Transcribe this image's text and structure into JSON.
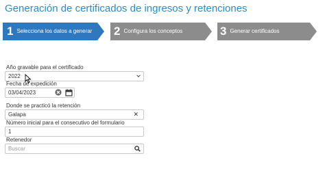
{
  "page": {
    "title": "Generación de certificados de ingresos y retenciones"
  },
  "steps": [
    {
      "number": "1",
      "label": "Selecciona los datos a generar",
      "state": "active",
      "color": "#2f78bd"
    },
    {
      "number": "2",
      "label": "Configura los conceptos",
      "state": "inactive",
      "color": "#8c8c8c"
    },
    {
      "number": "3",
      "label": "Generar certificados",
      "state": "inactive",
      "color": "#8c8c8c"
    }
  ],
  "form": {
    "year": {
      "label": "Año gravable para el certificado",
      "value": "2022",
      "icon": "chevron-down-icon"
    },
    "date": {
      "label": "Fecha de expedición",
      "value": "03/04/2023",
      "icons": [
        "clear-icon",
        "calendar-icon"
      ]
    },
    "place": {
      "label": "Donde se practicó la retención",
      "value": "Galapa",
      "icon": "close-icon"
    },
    "consecutive": {
      "label": "Número inicial para el consecutivo del formulario",
      "value": "1"
    },
    "retainer": {
      "label": "Retenedor",
      "placeholder": "Buscar",
      "icon": "search-icon"
    }
  },
  "colors": {
    "accent": "#2e8bc9",
    "active_step": "#2f78bd",
    "inactive_step": "#8c8c8c"
  }
}
